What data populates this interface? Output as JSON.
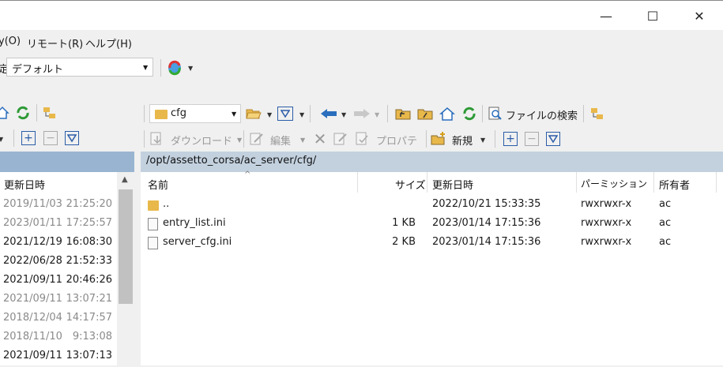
{
  "window": {
    "minimize_glyph": "—",
    "maximize_glyph": "☐",
    "close_glyph": "✕"
  },
  "menu": {
    "items": [
      "y(O)",
      "リモート(R)",
      "ヘルプ(H)"
    ]
  },
  "profile": {
    "label_partial": "定",
    "selected": "デフォルト"
  },
  "right_toolbar": {
    "folder_combo": "cfg",
    "search_label": "ファイルの検索",
    "download_label": "ダウンロード",
    "edit_label": "編集",
    "properties_label": "プロパティ",
    "new_label": "新規"
  },
  "left_panel": {
    "column_header": "更新日時",
    "dates": [
      {
        "date": "2019/11/03",
        "time": "21:25:20",
        "muted": true
      },
      {
        "date": "2023/01/11",
        "time": "17:25:57",
        "muted": true
      },
      {
        "date": "2021/12/19",
        "time": "16:08:30",
        "muted": false
      },
      {
        "date": "2022/06/28",
        "time": "21:52:33",
        "muted": false
      },
      {
        "date": "2021/09/11",
        "time": "20:46:26",
        "muted": false
      },
      {
        "date": "2021/09/11",
        "time": "13:07:21",
        "muted": true
      },
      {
        "date": "2018/12/04",
        "time": "14:17:57",
        "muted": true
      },
      {
        "date": "2018/11/10",
        "time": "9:13:08",
        "muted": true
      },
      {
        "date": "2021/09/11",
        "time": "13:07:13",
        "muted": false
      }
    ]
  },
  "right_panel": {
    "path": "/opt/assetto_corsa/ac_server/cfg/",
    "columns": {
      "name": "名前",
      "size": "サイズ",
      "modified": "更新日時",
      "permissions": "パーミッション",
      "owner": "所有者"
    },
    "rows": [
      {
        "name": "..",
        "size": "",
        "modified": "2022/10/21 15:33:35",
        "permissions": "rwxrwxr-x",
        "owner": "ac",
        "kind": "parent"
      },
      {
        "name": "entry_list.ini",
        "size": "1 KB",
        "modified": "2023/01/14 17:15:36",
        "permissions": "rwxrwxr-x",
        "owner": "ac",
        "kind": "file"
      },
      {
        "name": "server_cfg.ini",
        "size": "2 KB",
        "modified": "2023/01/14 17:15:36",
        "permissions": "rwxrwxr-x",
        "owner": "ac",
        "kind": "file"
      }
    ]
  }
}
